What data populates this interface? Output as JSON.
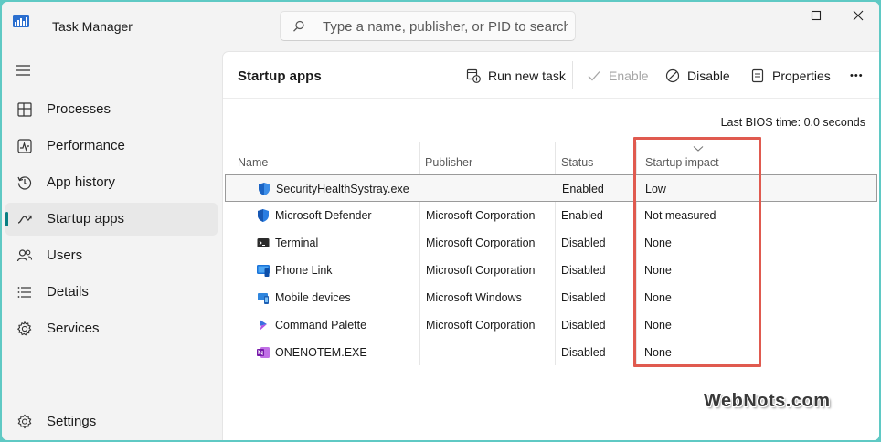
{
  "window": {
    "title": "Task Manager",
    "search_placeholder": "Type a name, publisher, or PID to search"
  },
  "sidebar": {
    "items": [
      {
        "label": "Processes",
        "icon": "processes-icon"
      },
      {
        "label": "Performance",
        "icon": "performance-icon"
      },
      {
        "label": "App history",
        "icon": "app-history-icon"
      },
      {
        "label": "Startup apps",
        "icon": "startup-apps-icon",
        "active": true
      },
      {
        "label": "Users",
        "icon": "users-icon"
      },
      {
        "label": "Details",
        "icon": "details-icon"
      },
      {
        "label": "Services",
        "icon": "services-icon"
      }
    ],
    "settings_label": "Settings"
  },
  "page": {
    "title": "Startup apps",
    "commands": {
      "run_new_task": "Run new task",
      "enable": "Enable",
      "disable": "Disable",
      "properties": "Properties",
      "more": "•••"
    },
    "bios_label": "Last BIOS time:",
    "bios_value": "0.0 seconds"
  },
  "table": {
    "columns": [
      "Name",
      "Publisher",
      "Status",
      "Startup impact"
    ],
    "rows": [
      {
        "name": "SecurityHealthSystray.exe",
        "publisher": "",
        "status": "Enabled",
        "impact": "Low",
        "icon": "windows-security-shield-icon"
      },
      {
        "name": "Microsoft Defender",
        "publisher": "Microsoft Corporation",
        "status": "Enabled",
        "impact": "Not measured",
        "icon": "defender-shield-icon"
      },
      {
        "name": "Terminal",
        "publisher": "Microsoft Corporation",
        "status": "Disabled",
        "impact": "None",
        "icon": "terminal-icon"
      },
      {
        "name": "Phone Link",
        "publisher": "Microsoft Corporation",
        "status": "Disabled",
        "impact": "None",
        "icon": "phone-link-icon"
      },
      {
        "name": "Mobile devices",
        "publisher": "Microsoft Windows",
        "status": "Disabled",
        "impact": "None",
        "icon": "mobile-devices-icon"
      },
      {
        "name": "Command Palette",
        "publisher": "Microsoft Corporation",
        "status": "Disabled",
        "impact": "None",
        "icon": "command-palette-icon"
      },
      {
        "name": "ONENOTEM.EXE",
        "publisher": "",
        "status": "Disabled",
        "impact": "None",
        "icon": "onenote-icon"
      }
    ]
  },
  "watermark": "WebNots.com",
  "colors": {
    "accent": "#0a7f83",
    "highlight": "#e05a4f",
    "background": "#5fc9c4"
  }
}
